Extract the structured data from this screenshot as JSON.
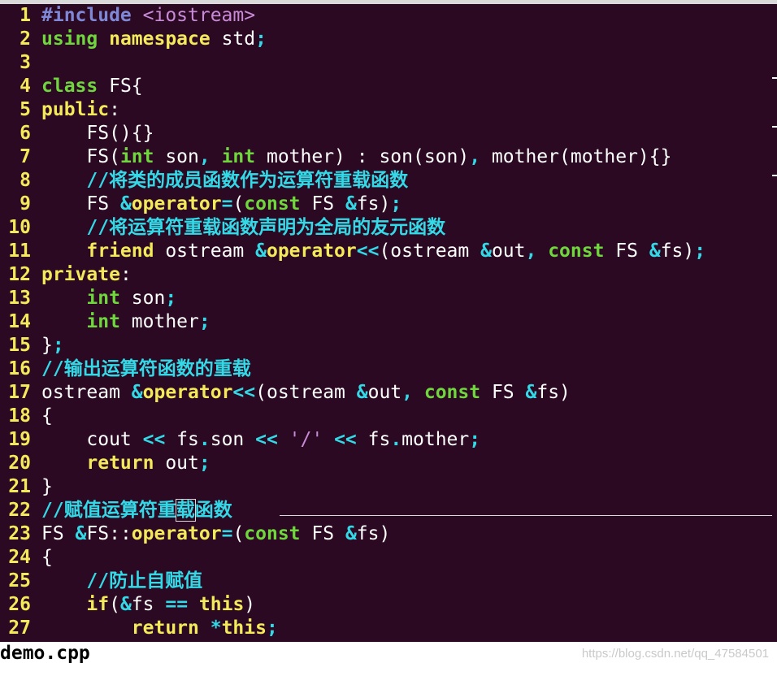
{
  "window": {
    "filename": "demo.cpp",
    "watermark": "https://blog.csdn.net/qq_47584501"
  },
  "colors": {
    "background": "#2c0922",
    "line_number": "#f3e95a",
    "keyword_type": "#6fd63e",
    "keyword_statement": "#f3e95a",
    "comment": "#33d9e6",
    "preprocessor": "#7e88d6",
    "string": "#c88bd7",
    "plain": "#ffffff"
  },
  "lines": [
    {
      "n": "1",
      "t": [
        [
          "pp",
          "#include "
        ],
        [
          "str",
          "<iostream>"
        ]
      ]
    },
    {
      "n": "2",
      "t": [
        [
          "kw-type",
          "using "
        ],
        [
          "kw-stmt",
          "namespace "
        ],
        [
          "plain",
          "std"
        ],
        [
          "op",
          ";"
        ]
      ]
    },
    {
      "n": "3",
      "t": []
    },
    {
      "n": "4",
      "t": [
        [
          "kw-type",
          "class "
        ],
        [
          "plain",
          "FS{"
        ]
      ]
    },
    {
      "n": "5",
      "t": [
        [
          "kw-stmt",
          "public"
        ],
        [
          "plain",
          ":"
        ]
      ]
    },
    {
      "n": "6",
      "t": [
        [
          "plain",
          "    FS(){}"
        ]
      ]
    },
    {
      "n": "7",
      "t": [
        [
          "plain",
          "    FS("
        ],
        [
          "kw-type",
          "int "
        ],
        [
          "plain",
          "son"
        ],
        [
          "op",
          ", "
        ],
        [
          "kw-type",
          "int "
        ],
        [
          "plain",
          "mother) : son(son)"
        ],
        [
          "op",
          ", "
        ],
        [
          "plain",
          "mother(mother){}"
        ]
      ]
    },
    {
      "n": "8",
      "t": [
        [
          "plain",
          "    "
        ],
        [
          "cmt",
          "//将类的成员函数作为运算符重载函数"
        ]
      ]
    },
    {
      "n": "9",
      "t": [
        [
          "plain",
          "    FS "
        ],
        [
          "op",
          "&"
        ],
        [
          "kw-stmt",
          "operator"
        ],
        [
          "op",
          "="
        ],
        [
          "plain",
          "("
        ],
        [
          "kw-type",
          "const "
        ],
        [
          "plain",
          "FS "
        ],
        [
          "op",
          "&"
        ],
        [
          "plain",
          "fs)"
        ],
        [
          "op",
          ";"
        ]
      ]
    },
    {
      "n": "10",
      "t": [
        [
          "plain",
          "    "
        ],
        [
          "cmt",
          "//将运算符重载函数声明为全局的友元函数"
        ]
      ]
    },
    {
      "n": "11",
      "t": [
        [
          "plain",
          "    "
        ],
        [
          "kw-stmt",
          "friend "
        ],
        [
          "plain",
          "ostream "
        ],
        [
          "op",
          "&"
        ],
        [
          "kw-stmt",
          "operator"
        ],
        [
          "op",
          "<<"
        ],
        [
          "plain",
          "(ostream "
        ],
        [
          "op",
          "&"
        ],
        [
          "plain",
          "out"
        ],
        [
          "op",
          ", "
        ],
        [
          "kw-type",
          "const "
        ],
        [
          "plain",
          "FS "
        ],
        [
          "op",
          "&"
        ],
        [
          "plain",
          "fs)"
        ],
        [
          "op",
          ";"
        ]
      ]
    },
    {
      "n": "12",
      "t": [
        [
          "kw-stmt",
          "private"
        ],
        [
          "plain",
          ":"
        ]
      ]
    },
    {
      "n": "13",
      "t": [
        [
          "plain",
          "    "
        ],
        [
          "kw-type",
          "int "
        ],
        [
          "plain",
          "son"
        ],
        [
          "op",
          ";"
        ]
      ]
    },
    {
      "n": "14",
      "t": [
        [
          "plain",
          "    "
        ],
        [
          "kw-type",
          "int "
        ],
        [
          "plain",
          "mother"
        ],
        [
          "op",
          ";"
        ]
      ]
    },
    {
      "n": "15",
      "t": [
        [
          "plain",
          "}"
        ],
        [
          "op",
          ";"
        ]
      ]
    },
    {
      "n": "16",
      "t": [
        [
          "cmt",
          "//输出运算符函数的重载"
        ]
      ]
    },
    {
      "n": "17",
      "t": [
        [
          "plain",
          "ostream "
        ],
        [
          "op",
          "&"
        ],
        [
          "kw-stmt",
          "operator"
        ],
        [
          "op",
          "<<"
        ],
        [
          "plain",
          "(ostream "
        ],
        [
          "op",
          "&"
        ],
        [
          "plain",
          "out"
        ],
        [
          "op",
          ", "
        ],
        [
          "kw-type",
          "const "
        ],
        [
          "plain",
          "FS "
        ],
        [
          "op",
          "&"
        ],
        [
          "plain",
          "fs)"
        ]
      ]
    },
    {
      "n": "18",
      "t": [
        [
          "plain",
          "{"
        ]
      ]
    },
    {
      "n": "19",
      "t": [
        [
          "plain",
          "    cout "
        ],
        [
          "op",
          "<< "
        ],
        [
          "plain",
          "fs"
        ],
        [
          "op",
          "."
        ],
        [
          "plain",
          "son "
        ],
        [
          "op",
          "<< "
        ],
        [
          "str",
          "'/' "
        ],
        [
          "op",
          "<< "
        ],
        [
          "plain",
          "fs"
        ],
        [
          "op",
          "."
        ],
        [
          "plain",
          "mother"
        ],
        [
          "op",
          ";"
        ]
      ]
    },
    {
      "n": "20",
      "t": [
        [
          "plain",
          "    "
        ],
        [
          "kw-stmt",
          "return "
        ],
        [
          "plain",
          "out"
        ],
        [
          "op",
          ";"
        ]
      ]
    },
    {
      "n": "21",
      "t": [
        [
          "plain",
          "}"
        ]
      ]
    },
    {
      "n": "22",
      "t": [
        [
          "cmt",
          "//赋值运算符重"
        ],
        [
          "cmt cursor-box",
          "载"
        ],
        [
          "cmt",
          "函数"
        ]
      ]
    },
    {
      "n": "23",
      "t": [
        [
          "plain",
          "FS "
        ],
        [
          "op",
          "&"
        ],
        [
          "plain",
          "FS::"
        ],
        [
          "kw-stmt",
          "operator"
        ],
        [
          "op",
          "="
        ],
        [
          "plain",
          "("
        ],
        [
          "kw-type",
          "const "
        ],
        [
          "plain",
          "FS "
        ],
        [
          "op",
          "&"
        ],
        [
          "plain",
          "fs)"
        ]
      ]
    },
    {
      "n": "24",
      "t": [
        [
          "plain",
          "{"
        ]
      ]
    },
    {
      "n": "25",
      "t": [
        [
          "plain",
          "    "
        ],
        [
          "cmt",
          "//防止自赋值"
        ]
      ]
    },
    {
      "n": "26",
      "t": [
        [
          "plain",
          "    "
        ],
        [
          "kw-stmt",
          "if"
        ],
        [
          "plain",
          "("
        ],
        [
          "op",
          "&"
        ],
        [
          "plain",
          "fs "
        ],
        [
          "op",
          "== "
        ],
        [
          "kw-stmt",
          "this"
        ],
        [
          "plain",
          ")"
        ]
      ]
    },
    {
      "n": "27",
      "t": [
        [
          "plain",
          "        "
        ],
        [
          "kw-stmt",
          "return "
        ],
        [
          "op",
          "*"
        ],
        [
          "kw-stmt",
          "this"
        ],
        [
          "op",
          ";"
        ]
      ]
    }
  ]
}
